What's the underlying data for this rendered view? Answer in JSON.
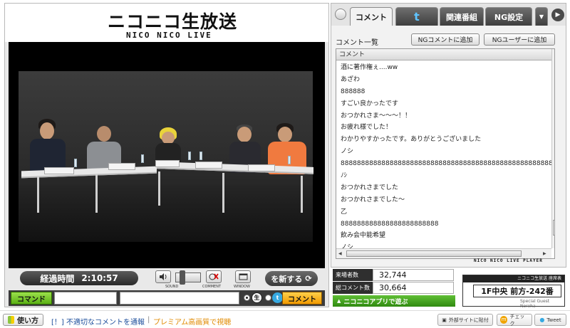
{
  "logo": {
    "main": "ニコニコ生放送",
    "sub": "NICO NICO LIVE"
  },
  "player": {
    "elapsed_label": "経過時間",
    "elapsed_time": "2:10:57",
    "sound_caption": "SOUND",
    "comment_caption": "COMMENT",
    "window_caption": "WINDOW",
    "share_label": "を新する"
  },
  "command_bar": {
    "command_label": "コマンド",
    "send_label": "コメント"
  },
  "panel": {
    "tabs": [
      {
        "label": "コメント"
      },
      {
        "label": "t"
      },
      {
        "label": "関連番組"
      },
      {
        "label": "NG設定"
      }
    ],
    "tabs_more": "▼",
    "list_title": "コメント一覧",
    "ng_comment_button": "NGコメントに追加",
    "ng_user_button": "NGユーザーに追加",
    "column_header": "コメント",
    "comments": [
      "酒に著作権ぇ....ww",
      "あざわ",
      "888888",
      "すごい良かったです",
      "おつかれさま〜〜〜！！",
      "お疲れ様でした！",
      "わかりやすかったです。ありがとうございました",
      "ノシ",
      "8888888888888888888888888888888888888888888888888888888888",
      "ﾉｼ",
      "おつかれさまでした",
      "おつかれさまでした〜",
      "乙",
      "888888888888888888888888",
      "飲み会中能希望",
      "ノシ"
    ],
    "player_label": "NICO NICO LIVE PLAYER"
  },
  "stats": {
    "visitors_label": "来場者数",
    "visitors_value": "32,744",
    "comments_label": "総コメント数",
    "comments_value": "30,664",
    "app_label": "ニコニコアプリで遊ぶ"
  },
  "seat": {
    "title": "ニコニコ生放送 座席表",
    "number": "1F中央 前方-242番",
    "guest": "Special Guest Noreha"
  },
  "footer": {
    "howto": "使い方",
    "report_bang": "[！]",
    "report": "不適切なコメントを通報",
    "separator": "|",
    "premium": "プレミアム高画質で視聴",
    "share_site": "外部サイトに貼付",
    "check": "チェック",
    "tweet": "Tweet"
  }
}
